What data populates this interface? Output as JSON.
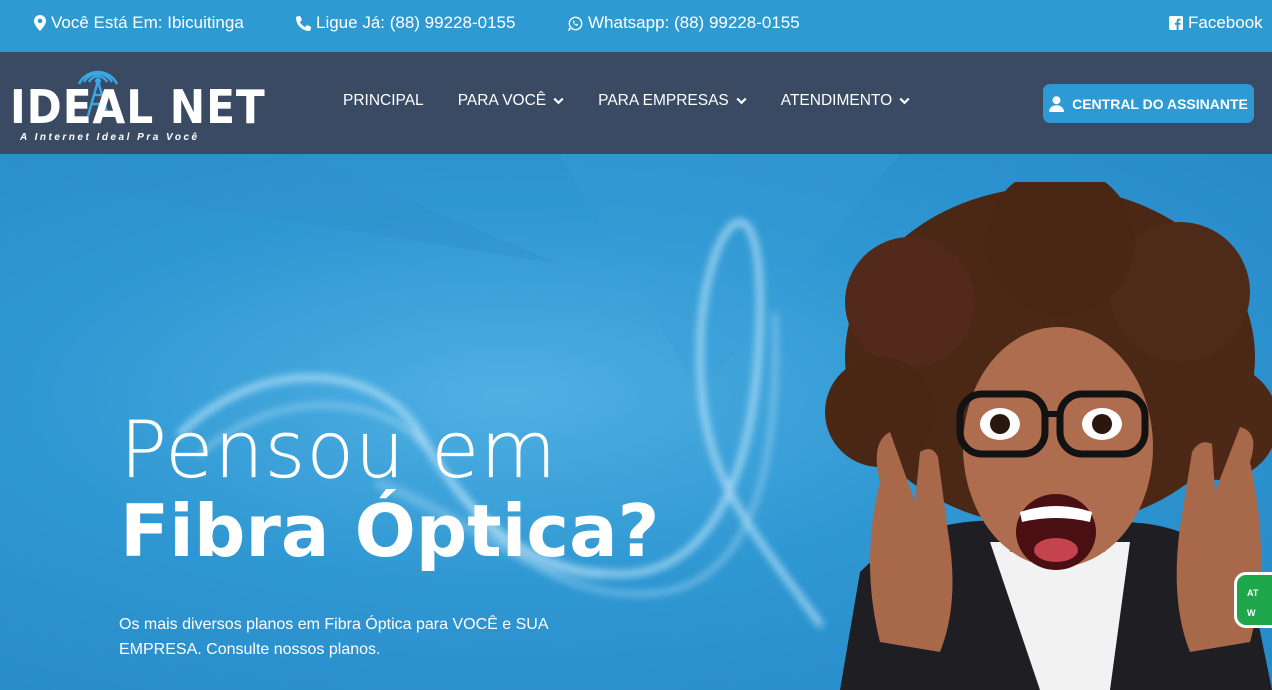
{
  "topbar": {
    "location": "Você Está Em: Ibicuitinga",
    "phone": "Ligue Já: (88) 99228-0155",
    "whatsapp": "Whatsapp: (88) 99228-0155",
    "facebook": "Facebook"
  },
  "logo": {
    "name": "IDEAL NET",
    "tagline": "A Internet Ideal Pra Você"
  },
  "nav": {
    "items": [
      {
        "label": "PRINCIPAL",
        "has_dropdown": false
      },
      {
        "label": "PARA VOCÊ",
        "has_dropdown": true
      },
      {
        "label": "PARA EMPRESAS",
        "has_dropdown": true
      },
      {
        "label": "ATENDIMENTO",
        "has_dropdown": true
      }
    ],
    "cta_label": "CENTRAL DO ASSINANTE"
  },
  "hero": {
    "line1": "Pensou em",
    "line2": "Fibra Óptica?",
    "subtitle": "Os mais diversos planos em Fibra Óptica para VOCÊ e SUA EMPRESA. Consulte nossos planos."
  },
  "floating_tab": {
    "line1": "AT",
    "line2": "W"
  },
  "colors": {
    "topbar": "#2e9ad2",
    "navbar": "#3a4a63",
    "accent": "#2d9ad4",
    "whatsapp_green": "#1ea64a"
  },
  "icons": [
    "map-marker-icon",
    "phone-icon",
    "whatsapp-icon",
    "facebook-icon",
    "chevron-down-icon",
    "user-icon"
  ]
}
